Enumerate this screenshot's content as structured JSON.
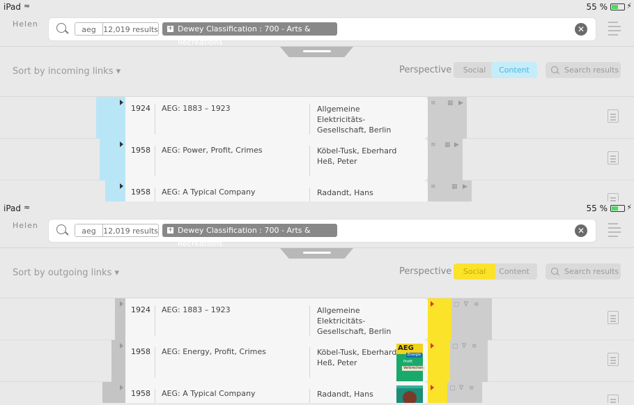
{
  "status": {
    "device": "iPad",
    "battery": "55 %"
  },
  "logo": {
    "text": "Helen"
  },
  "search": {
    "term": "aeg",
    "count": "12,019 results",
    "filter": "Dewey Classification : 700 - Arts & Recreations"
  },
  "screens": [
    {
      "sort_label": "Sort by incoming links",
      "perspective_label": "Perspective",
      "toggle": {
        "social": "Social",
        "content": "Content",
        "active": "Content"
      },
      "search_placeholder": "Search results",
      "rows": [
        {
          "year": "1924",
          "title": "AEG: 1883 – 1923",
          "authors": [
            "Allgemeine",
            "Elektricitäts-",
            "Gesellschaft, Berlin"
          ]
        },
        {
          "year": "1958",
          "title": "AEG: Power, Profit, Crimes",
          "authors": [
            "Köbel-Tusk, Eberhard",
            "Heß, Peter"
          ]
        },
        {
          "year": "1958",
          "title": "AEG: A Typical Company",
          "authors": [
            "Radandt, Hans"
          ]
        }
      ]
    },
    {
      "sort_label": "Sort by outgoing links",
      "perspective_label": "Perspective",
      "toggle": {
        "social": "Social",
        "content": "Content",
        "active": "Social"
      },
      "search_placeholder": "Search results",
      "rows": [
        {
          "year": "1924",
          "title": "AEG: 1883 – 1923",
          "authors": [
            "Allgemeine",
            "Elektricitäts-",
            "Gesellschaft, Berlin"
          ]
        },
        {
          "year": "1958",
          "title": "AEG: Energy, Profit, Crimes",
          "authors": [
            "Köbel-Tusk, Eberhard",
            "Heß, Peter"
          ],
          "thumb": {
            "title": "AEG",
            "lines": [
              "Energie",
              "Profit",
              "Verbrechen"
            ]
          }
        },
        {
          "year": "1958",
          "title": "AEG: A Typical Company",
          "authors": [
            "Radandt, Hans"
          ]
        }
      ]
    }
  ],
  "colors": {
    "content_accent": "#b8e6f7",
    "social_accent": "#fbe32a"
  }
}
